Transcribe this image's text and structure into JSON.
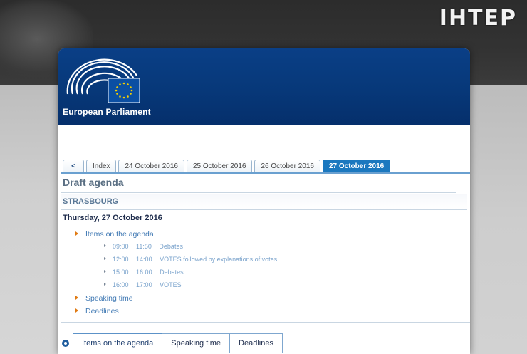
{
  "overlay": {
    "channel_logo": "ІНТЕР"
  },
  "header": {
    "org_name": "European Parliament"
  },
  "tabs": [
    {
      "label": "<"
    },
    {
      "label": "Index"
    },
    {
      "label": "24 October 2016"
    },
    {
      "label": "25 October 2016"
    },
    {
      "label": "26 October 2016"
    },
    {
      "label": "27 October 2016",
      "active": true
    }
  ],
  "page": {
    "title": "Draft agenda",
    "city": "STRASBOURG",
    "date_heading": "Thursday, 27 October 2016"
  },
  "toc": {
    "items_label": "Items on the agenda",
    "entries": [
      {
        "start": "09:00",
        "end": "11:50",
        "text": "Debates"
      },
      {
        "start": "12:00",
        "end": "14:00",
        "text": "VOTES followed by explanations of votes"
      },
      {
        "start": "15:00",
        "end": "16:00",
        "text": "Debates"
      },
      {
        "start": "16:00",
        "end": "17:00",
        "text": "VOTES"
      }
    ],
    "speaking_label": "Speaking time",
    "deadlines_label": "Deadlines"
  },
  "bottom_tabs": [
    {
      "label": "Items on the agenda",
      "active": true
    },
    {
      "label": "Speaking time"
    },
    {
      "label": "Deadlines"
    }
  ],
  "colors": {
    "header": "#073879",
    "active_tab": "#1b78bf",
    "link": "#3f78b3",
    "arrow": "#e07a12"
  }
}
